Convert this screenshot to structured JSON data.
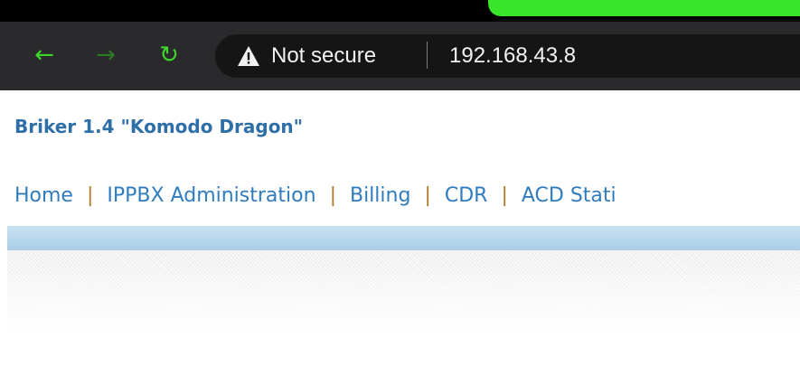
{
  "browser": {
    "nav": {
      "back_icon": "arrow-left-icon",
      "forward_icon": "arrow-right-icon",
      "reload_icon": "reload-icon",
      "back_glyph": "←",
      "forward_glyph": "→",
      "reload_glyph": "↻"
    },
    "omnibox": {
      "security_icon": "warning-triangle-icon",
      "security_label": "Not secure",
      "url": "192.168.43.8"
    },
    "colors": {
      "chrome_bg": "#2a2a2c",
      "tab_accent": "#39e52a",
      "nav_icon": "#3fd62b"
    }
  },
  "page": {
    "site_title": "Briker 1.4 \"Komodo Dragon\"",
    "menu": {
      "items": [
        "Home",
        "IPPBX Administration",
        "Billing",
        "CDR",
        "ACD Stati"
      ],
      "separator": "|"
    },
    "colors": {
      "title": "#2f6fa8",
      "link": "#2f7cbf",
      "separator": "#b07a2a",
      "bar": "#a9cde6"
    }
  }
}
